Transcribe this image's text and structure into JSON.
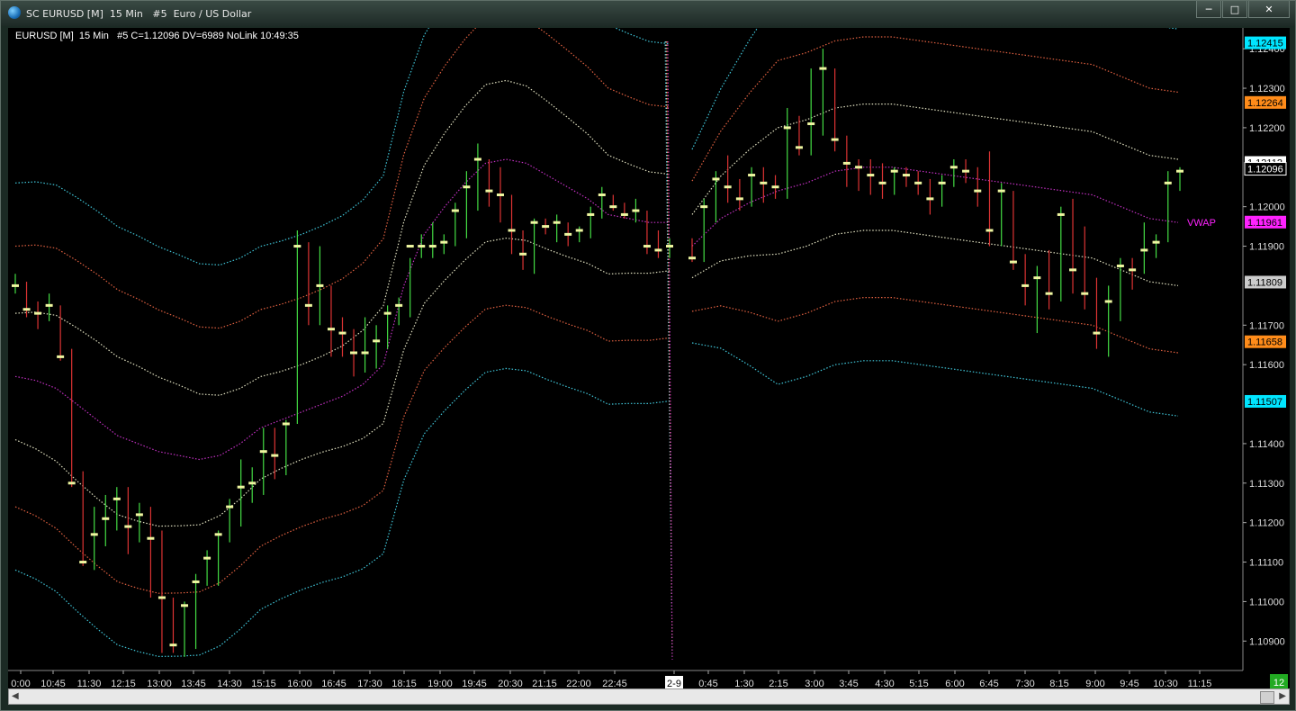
{
  "window": {
    "title": "SC EURUSD [M]  15 Min   #5  Euro / US Dollar",
    "buttons": {
      "minimize": "─",
      "maximize": "□",
      "close": "✕"
    }
  },
  "study_label": "EURUSD [M]  15 Min   #5 C=1.12096 DV=6989 NoLink 10:49:35",
  "colors": {
    "bg": "#000000",
    "up": "#44dd44",
    "down": "#dd3333",
    "bar_marker": "#eef6a0",
    "outer_band": "#3fc5d8",
    "inner_band": "#e0e0c0",
    "mid_band": "#e06040",
    "vwap": "#c030c0"
  },
  "chart_data": {
    "type": "ohlc-candles",
    "symbol": "EURUSD",
    "interval": "15 Min",
    "ylim": [
      1.1083,
      1.1243
    ],
    "y_ticks": [
      "1.12400",
      "1.12300",
      "1.12200",
      "1.12000",
      "1.11900",
      "1.11700",
      "1.11600",
      "1.11400",
      "1.11300",
      "1.11200",
      "1.11100",
      "1.11000",
      "1.10900"
    ],
    "x_ticks": [
      "0:00",
      "10:45",
      "11:30",
      "12:15",
      "13:00",
      "13:45",
      "14:30",
      "15:15",
      "16:00",
      "16:45",
      "17:30",
      "18:15",
      "19:00",
      "19:45",
      "20:30",
      "21:15",
      "22:00",
      "22:45",
      "2-9",
      "0:45",
      "1:30",
      "2:15",
      "3:00",
      "3:45",
      "4:30",
      "5:15",
      "6:00",
      "6:45",
      "7:30",
      "8:15",
      "9:00",
      "9:45",
      "10:30",
      "11:15"
    ],
    "price_labels": [
      {
        "text": "1.12415",
        "value": 1.12415,
        "bg": "#00e5ff",
        "fg": "#000000"
      },
      {
        "text": "1.12264",
        "value": 1.12264,
        "bg": "#ff8c1a",
        "fg": "#000000"
      },
      {
        "text": "1.12112",
        "value": 1.12112,
        "bg": "#ffffff",
        "fg": "#000000"
      },
      {
        "text": "1.12096",
        "value": 1.12096,
        "bg": "#000000",
        "fg": "#ffffff"
      },
      {
        "text": "1.11961",
        "value": 1.11961,
        "bg": "#ff22ff",
        "fg": "#000000"
      },
      {
        "text": "1.11809",
        "value": 1.11809,
        "bg": "#cccccc",
        "fg": "#000000"
      },
      {
        "text": "1.11658",
        "value": 1.11658,
        "bg": "#ff8c1a",
        "fg": "#000000"
      },
      {
        "text": "1.11507",
        "value": 1.11507,
        "bg": "#00e5ff",
        "fg": "#000000"
      }
    ],
    "vwap_label": "VWAP",
    "session_marker": "2-9",
    "bar_count_badge": "12",
    "candles": [
      [
        1.1179,
        1.1183,
        1.1178,
        1.118
      ],
      [
        1.118,
        1.1181,
        1.1172,
        1.1174
      ],
      [
        1.1174,
        1.1176,
        1.1169,
        1.1173
      ],
      [
        1.1173,
        1.1178,
        1.1171,
        1.1175
      ],
      [
        1.1175,
        1.1175,
        1.1161,
        1.1162
      ],
      [
        1.1162,
        1.1164,
        1.1129,
        1.113
      ],
      [
        1.113,
        1.1133,
        1.1109,
        1.111
      ],
      [
        1.111,
        1.1124,
        1.1108,
        1.1117
      ],
      [
        1.1117,
        1.1127,
        1.1114,
        1.1121
      ],
      [
        1.1121,
        1.1129,
        1.1118,
        1.1126
      ],
      [
        1.1126,
        1.1129,
        1.1112,
        1.1119
      ],
      [
        1.1119,
        1.1125,
        1.1115,
        1.1122
      ],
      [
        1.1122,
        1.1124,
        1.1101,
        1.1116
      ],
      [
        1.1116,
        1.1118,
        1.1087,
        1.1101
      ],
      [
        1.1101,
        1.1101,
        1.1087,
        1.1089
      ],
      [
        1.1089,
        1.11,
        1.1086,
        1.1099
      ],
      [
        1.1099,
        1.1107,
        1.1088,
        1.1105
      ],
      [
        1.1105,
        1.1113,
        1.1104,
        1.1111
      ],
      [
        1.1111,
        1.1118,
        1.1104,
        1.1117
      ],
      [
        1.1117,
        1.1126,
        1.1115,
        1.1124
      ],
      [
        1.1124,
        1.1136,
        1.1119,
        1.1129
      ],
      [
        1.1129,
        1.1134,
        1.1125,
        1.113
      ],
      [
        1.113,
        1.1144,
        1.1127,
        1.1138
      ],
      [
        1.1138,
        1.1144,
        1.1131,
        1.1137
      ],
      [
        1.1137,
        1.1146,
        1.1132,
        1.1145
      ],
      [
        1.1145,
        1.1194,
        1.1145,
        1.119
      ],
      [
        1.119,
        1.1191,
        1.117,
        1.1175
      ],
      [
        1.1175,
        1.119,
        1.117,
        1.118
      ],
      [
        1.118,
        1.118,
        1.1162,
        1.1169
      ],
      [
        1.1169,
        1.1172,
        1.1162,
        1.1168
      ],
      [
        1.1168,
        1.1169,
        1.1157,
        1.1163
      ],
      [
        1.1163,
        1.1172,
        1.1158,
        1.1163
      ],
      [
        1.1163,
        1.117,
        1.1159,
        1.1166
      ],
      [
        1.1166,
        1.1175,
        1.1164,
        1.1173
      ],
      [
        1.1173,
        1.1177,
        1.117,
        1.1175
      ],
      [
        1.1175,
        1.1187,
        1.1172,
        1.119
      ],
      [
        1.119,
        1.1193,
        1.1187,
        1.119
      ],
      [
        1.119,
        1.1196,
        1.1187,
        1.119
      ],
      [
        1.119,
        1.1193,
        1.1188,
        1.1191
      ],
      [
        1.1191,
        1.1201,
        1.119,
        1.1199
      ],
      [
        1.1199,
        1.1209,
        1.1192,
        1.1205
      ],
      [
        1.1205,
        1.1216,
        1.1199,
        1.1212
      ],
      [
        1.1212,
        1.1212,
        1.12,
        1.1204
      ],
      [
        1.1204,
        1.121,
        1.1196,
        1.1203
      ],
      [
        1.1203,
        1.1203,
        1.1188,
        1.1194
      ],
      [
        1.1194,
        1.1194,
        1.1184,
        1.1188
      ],
      [
        1.1188,
        1.1197,
        1.1183,
        1.1196
      ],
      [
        1.1196,
        1.1197,
        1.1193,
        1.1195
      ],
      [
        1.1195,
        1.1198,
        1.1191,
        1.1196
      ],
      [
        1.1196,
        1.1196,
        1.119,
        1.1193
      ],
      [
        1.1193,
        1.1195,
        1.1191,
        1.1194
      ],
      [
        1.1194,
        1.12,
        1.1192,
        1.1198
      ],
      [
        1.1198,
        1.1205,
        1.1197,
        1.1203
      ],
      [
        1.1203,
        1.1203,
        1.1199,
        1.12
      ],
      [
        1.12,
        1.1201,
        1.1197,
        1.1198
      ],
      [
        1.1198,
        1.1202,
        1.1196,
        1.1199
      ],
      [
        1.1199,
        1.1199,
        1.1188,
        1.119
      ],
      [
        1.119,
        1.1194,
        1.1187,
        1.1189
      ],
      [
        1.1189,
        1.1192,
        1.1187,
        1.119
      ],
      [
        1.119,
        1.1192,
        1.1186,
        1.1187
      ],
      [
        1.1187,
        1.1202,
        1.1186,
        1.12
      ],
      [
        1.12,
        1.1209,
        1.1196,
        1.1207
      ],
      [
        1.1207,
        1.1213,
        1.1201,
        1.1205
      ],
      [
        1.1205,
        1.1207,
        1.1199,
        1.1202
      ],
      [
        1.1202,
        1.121,
        1.12,
        1.1208
      ],
      [
        1.1208,
        1.121,
        1.1201,
        1.1206
      ],
      [
        1.1206,
        1.1208,
        1.1202,
        1.1205
      ],
      [
        1.1205,
        1.1225,
        1.1202,
        1.122
      ],
      [
        1.122,
        1.1223,
        1.1213,
        1.1215
      ],
      [
        1.1215,
        1.1235,
        1.1213,
        1.1221
      ],
      [
        1.1221,
        1.124,
        1.1218,
        1.1235
      ],
      [
        1.1235,
        1.1235,
        1.1214,
        1.1217
      ],
      [
        1.1217,
        1.1218,
        1.1205,
        1.1211
      ],
      [
        1.1211,
        1.1212,
        1.1204,
        1.121
      ],
      [
        1.121,
        1.1212,
        1.1203,
        1.1208
      ],
      [
        1.1208,
        1.1211,
        1.1202,
        1.1206
      ],
      [
        1.1206,
        1.121,
        1.1203,
        1.1209
      ],
      [
        1.1209,
        1.121,
        1.1205,
        1.1208
      ],
      [
        1.1208,
        1.1209,
        1.1203,
        1.1206
      ],
      [
        1.1206,
        1.1207,
        1.1198,
        1.1202
      ],
      [
        1.1202,
        1.1208,
        1.12,
        1.1206
      ],
      [
        1.1206,
        1.1212,
        1.1205,
        1.121
      ],
      [
        1.121,
        1.1212,
        1.1206,
        1.1209
      ],
      [
        1.1209,
        1.121,
        1.12,
        1.1204
      ],
      [
        1.1204,
        1.1214,
        1.119,
        1.1194
      ],
      [
        1.1194,
        1.1206,
        1.119,
        1.1204
      ],
      [
        1.1204,
        1.1204,
        1.1184,
        1.1186
      ],
      [
        1.1186,
        1.1188,
        1.1175,
        1.118
      ],
      [
        1.118,
        1.1185,
        1.1168,
        1.1182
      ],
      [
        1.1182,
        1.1189,
        1.1174,
        1.1178
      ],
      [
        1.1178,
        1.12,
        1.1176,
        1.1198
      ],
      [
        1.1198,
        1.1202,
        1.1178,
        1.1184
      ],
      [
        1.1184,
        1.1195,
        1.1174,
        1.1178
      ],
      [
        1.1178,
        1.1182,
        1.1164,
        1.1168
      ],
      [
        1.1168,
        1.118,
        1.1162,
        1.1176
      ],
      [
        1.1176,
        1.1187,
        1.1171,
        1.1185
      ],
      [
        1.1185,
        1.1187,
        1.1179,
        1.1184
      ],
      [
        1.1184,
        1.1196,
        1.1183,
        1.1189
      ],
      [
        1.1189,
        1.1193,
        1.1187,
        1.1191
      ],
      [
        1.1191,
        1.1209,
        1.1191,
        1.1206
      ],
      [
        1.1206,
        1.121,
        1.1204,
        1.1209
      ]
    ],
    "session_break_index": 59,
    "bands": {
      "vwap": [
        1.1157,
        1.1156,
        1.1154,
        1.115,
        1.1146,
        1.1142,
        1.114,
        1.1138,
        1.1137,
        1.1136,
        1.1137,
        1.114,
        1.1144,
        1.1146,
        1.1148,
        1.115,
        1.1152,
        1.1155,
        1.116,
        1.118,
        1.1193,
        1.12,
        1.1206,
        1.1211,
        1.1212,
        1.1211,
        1.1208,
        1.1205,
        1.1202,
        1.1198,
        1.1197,
        1.1196,
        1.1196
      ],
      "inner_upper": [
        1.1173,
        1.117,
        1.1165,
        1.1163,
        1.1161,
        1.116,
        1.1176,
        1.118,
        1.1184,
        1.1186,
        1.1187,
        1.1188,
        1.1186,
        1.119,
        1.1198,
        1.1205,
        1.121,
        1.1222,
        1.122,
        1.1218,
        1.1216,
        1.1214,
        1.1213,
        1.1212,
        1.1212
      ],
      "mid_upper": [
        1.1192,
        1.1196,
        1.1195,
        1.119,
        1.1185,
        1.1195,
        1.1202,
        1.1208,
        1.121,
        1.1213,
        1.1215
      ],
      "outer_upper": [
        1.1208,
        1.1215,
        1.1222,
        1.1215,
        1.1205,
        1.1225,
        1.1234,
        1.1238,
        1.124,
        1.124
      ]
    }
  }
}
